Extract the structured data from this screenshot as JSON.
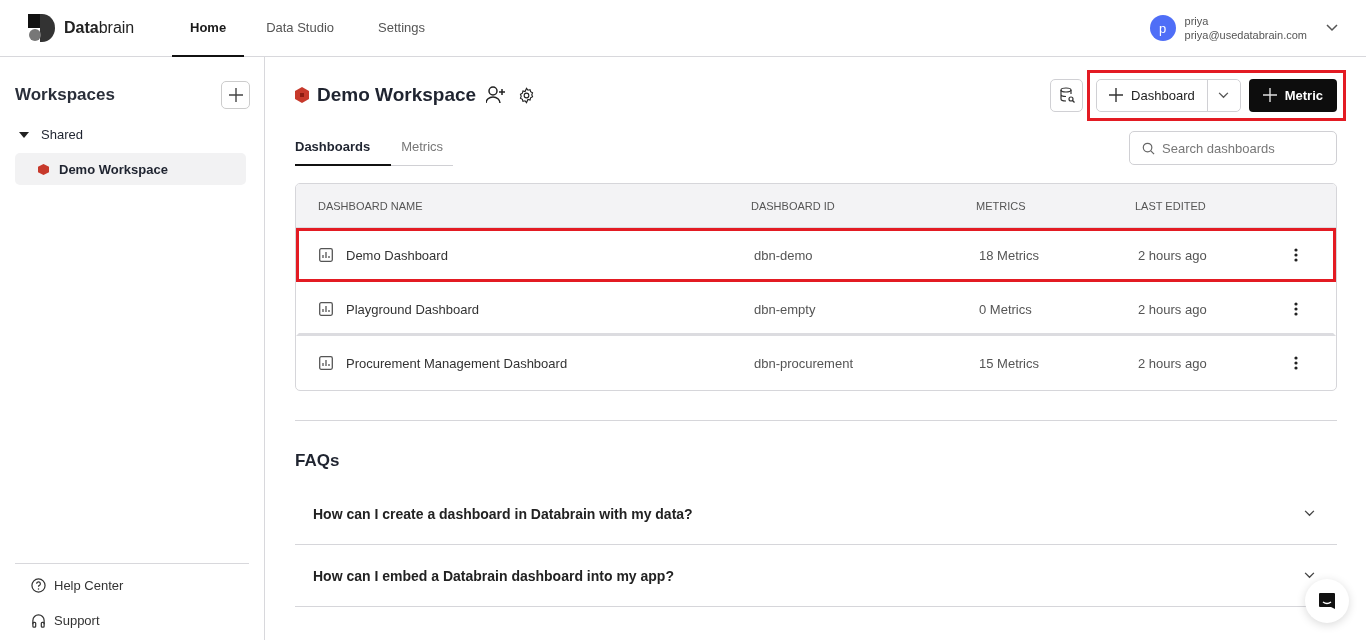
{
  "topbar": {
    "logo": "**Data**brain",
    "nav": [
      {
        "label": "Home",
        "selected": true
      },
      {
        "label": "Data Studio",
        "selected": false
      },
      {
        "label": "Settings",
        "selected": false
      }
    ],
    "user": {
      "initial": "p",
      "name": "priya",
      "email": "priya@usedatabrain.com"
    }
  },
  "sidebar": {
    "title": "Workspaces",
    "group": {
      "label": "Shared",
      "expanded": true,
      "children": [
        {
          "label": "Demo Workspace",
          "selected": true
        }
      ]
    },
    "footer": [
      {
        "kind": "help",
        "label": "Help Center"
      },
      {
        "kind": "support",
        "label": "Support"
      }
    ]
  },
  "workspace": {
    "title": "Demo Workspace",
    "actions_highlighted": true,
    "dashboard_button": "Dashboard",
    "metric_button": "Metric",
    "tabs": [
      {
        "label": "Dashboards",
        "selected": true
      },
      {
        "label": "Metrics",
        "selected": false
      }
    ],
    "search": {
      "placeholder": "Search dashboards"
    }
  },
  "table": {
    "columns": [
      "DASHBOARD NAME",
      "DASHBOARD ID",
      "METRICS",
      "LAST EDITED"
    ],
    "rows": [
      {
        "name": "Demo Dashboard",
        "id": "dbn-demo",
        "metrics": "18 Metrics",
        "edited": "2 hours ago",
        "highlighted": true
      },
      {
        "name": "Playground Dashboard",
        "id": "dbn-empty",
        "metrics": "0 Metrics",
        "edited": "2 hours ago",
        "highlighted": false
      },
      {
        "name": "Procurement Management Dashboard",
        "id": "dbn-procurement",
        "metrics": "15 Metrics",
        "edited": "2 hours ago",
        "highlighted": false
      }
    ]
  },
  "faq": {
    "title": "FAQs",
    "items": [
      {
        "question": "How can I create a dashboard in Databrain with my data?",
        "expanded": false
      },
      {
        "question": "How can I embed a Databrain dashboard into my app?",
        "expanded": false
      }
    ]
  }
}
